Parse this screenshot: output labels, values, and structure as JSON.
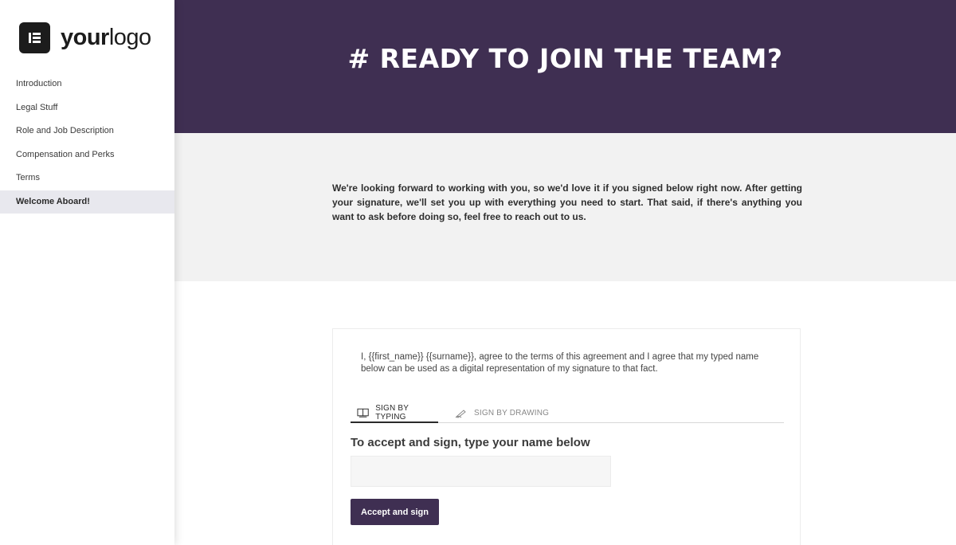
{
  "logo": {
    "text_bold": "your",
    "text_regular": "logo"
  },
  "sidebar": {
    "items": [
      {
        "label": "Introduction"
      },
      {
        "label": "Legal Stuff"
      },
      {
        "label": "Role and Job Description"
      },
      {
        "label": "Compensation and Perks"
      },
      {
        "label": "Terms"
      },
      {
        "label": "Welcome Aboard!",
        "active": true
      }
    ]
  },
  "hero": {
    "title": "# READY TO JOIN THE TEAM?"
  },
  "intro": {
    "text": "We're looking forward to working with you, so we'd love it if you signed below right now. After getting your signature, we'll set you up with everything you need to start. That said, if there's anything you want to ask before doing so, feel free to reach out to us."
  },
  "signature": {
    "agreement": "I, {{first_name}} {{surname}}, agree to the terms of this agreement and I agree that my typed name below can be used as a digital representation of my signature to that fact.",
    "tabs": [
      {
        "label": "SIGN BY TYPING",
        "icon": "keyboard-icon",
        "active": true
      },
      {
        "label": "SIGN BY DRAWING",
        "icon": "pen-icon",
        "active": false
      }
    ],
    "prompt": "To accept and sign, type your name below",
    "input_value": "",
    "button_label": "Accept and sign"
  },
  "colors": {
    "brand": "#3f2f52",
    "intro_bg": "#f2f2f2",
    "active_nav_bg": "#e8e8ee"
  }
}
